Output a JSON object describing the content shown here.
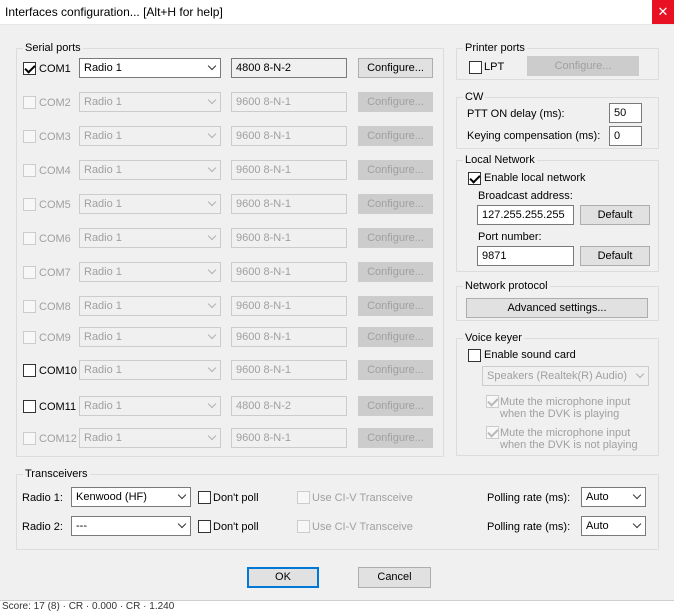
{
  "window": {
    "title": "Interfaces configuration... [Alt+H for help]",
    "close_glyph": "✕"
  },
  "serial_ports": {
    "title": "Serial ports",
    "rows": [
      {
        "port": "COM1",
        "checked": true,
        "enabled": true,
        "radio": "Radio 1",
        "params": "4800 8-N-2",
        "configure": "Configure..."
      },
      {
        "port": "COM2",
        "checked": false,
        "enabled": false,
        "radio": "Radio 1",
        "params": "9600 8-N-1",
        "configure": "Configure..."
      },
      {
        "port": "COM3",
        "checked": false,
        "enabled": false,
        "radio": "Radio 1",
        "params": "9600 8-N-1",
        "configure": "Configure..."
      },
      {
        "port": "COM4",
        "checked": false,
        "enabled": false,
        "radio": "Radio 1",
        "params": "9600 8-N-1",
        "configure": "Configure..."
      },
      {
        "port": "COM5",
        "checked": false,
        "enabled": false,
        "radio": "Radio 1",
        "params": "9600 8-N-1",
        "configure": "Configure..."
      },
      {
        "port": "COM6",
        "checked": false,
        "enabled": false,
        "radio": "Radio 1",
        "params": "9600 8-N-1",
        "configure": "Configure..."
      },
      {
        "port": "COM7",
        "checked": false,
        "enabled": false,
        "radio": "Radio 1",
        "params": "9600 8-N-1",
        "configure": "Configure..."
      },
      {
        "port": "COM8",
        "checked": false,
        "enabled": false,
        "radio": "Radio 1",
        "params": "9600 8-N-1",
        "configure": "Configure..."
      },
      {
        "port": "COM9",
        "checked": false,
        "enabled": false,
        "radio": "Radio 1",
        "params": "9600 8-N-1",
        "configure": "Configure..."
      },
      {
        "port": "COM10",
        "checked": false,
        "enabled": true,
        "radio": "Radio 1",
        "params": "9600 8-N-1",
        "configure": "Configure..."
      },
      {
        "port": "COM11",
        "checked": false,
        "enabled": true,
        "radio": "Radio 1",
        "params": "4800 8-N-2",
        "configure": "Configure..."
      },
      {
        "port": "COM12",
        "checked": false,
        "enabled": false,
        "radio": "Radio 1",
        "params": "9600 8-N-1",
        "configure": "Configure..."
      }
    ]
  },
  "printer_ports": {
    "title": "Printer ports",
    "lpt_label": "LPT",
    "lpt_checked": false,
    "configure": "Configure..."
  },
  "cw": {
    "title": "CW",
    "ptt_label": "PTT ON delay (ms):",
    "ptt_value": "50",
    "keying_label": "Keying compensation (ms):",
    "keying_value": "0"
  },
  "local_network": {
    "title": "Local Network",
    "enable_label": "Enable local network",
    "enable_checked": true,
    "broadcast_label": "Broadcast address:",
    "broadcast_value": "127.255.255.255",
    "port_label": "Port number:",
    "port_value": "9871",
    "default_label": "Default"
  },
  "network_protocol": {
    "title": "Network protocol",
    "advanced_label": "Advanced settings..."
  },
  "voice_keyer": {
    "title": "Voice keyer",
    "enable_label": "Enable sound card",
    "enable_checked": false,
    "device": "Speakers (Realtek(R) Audio)",
    "mute1_line1": "Mute the microphone input",
    "mute1_line2": "when the DVK is playing",
    "mute1_checked": true,
    "mute2_line1": "Mute the microphone input",
    "mute2_line2": "when the DVK is not playing",
    "mute2_checked": true
  },
  "transceivers": {
    "title": "Transceivers",
    "rows": [
      {
        "label": "Radio 1:",
        "model": "Kenwood (HF)",
        "dont_poll": "Don't poll",
        "civ": "Use CI-V Transceive",
        "polling_label": "Polling rate (ms):",
        "polling_value": "Auto"
      },
      {
        "label": "Radio 2:",
        "model": "---",
        "dont_poll": "Don't poll",
        "civ": "Use CI-V Transceive",
        "polling_label": "Polling rate (ms):",
        "polling_value": "Auto"
      }
    ]
  },
  "buttons": {
    "ok": "OK",
    "cancel": "Cancel"
  },
  "footer_text": "Score: 17 (8) · CR · 0.000 · CR · 1.240"
}
